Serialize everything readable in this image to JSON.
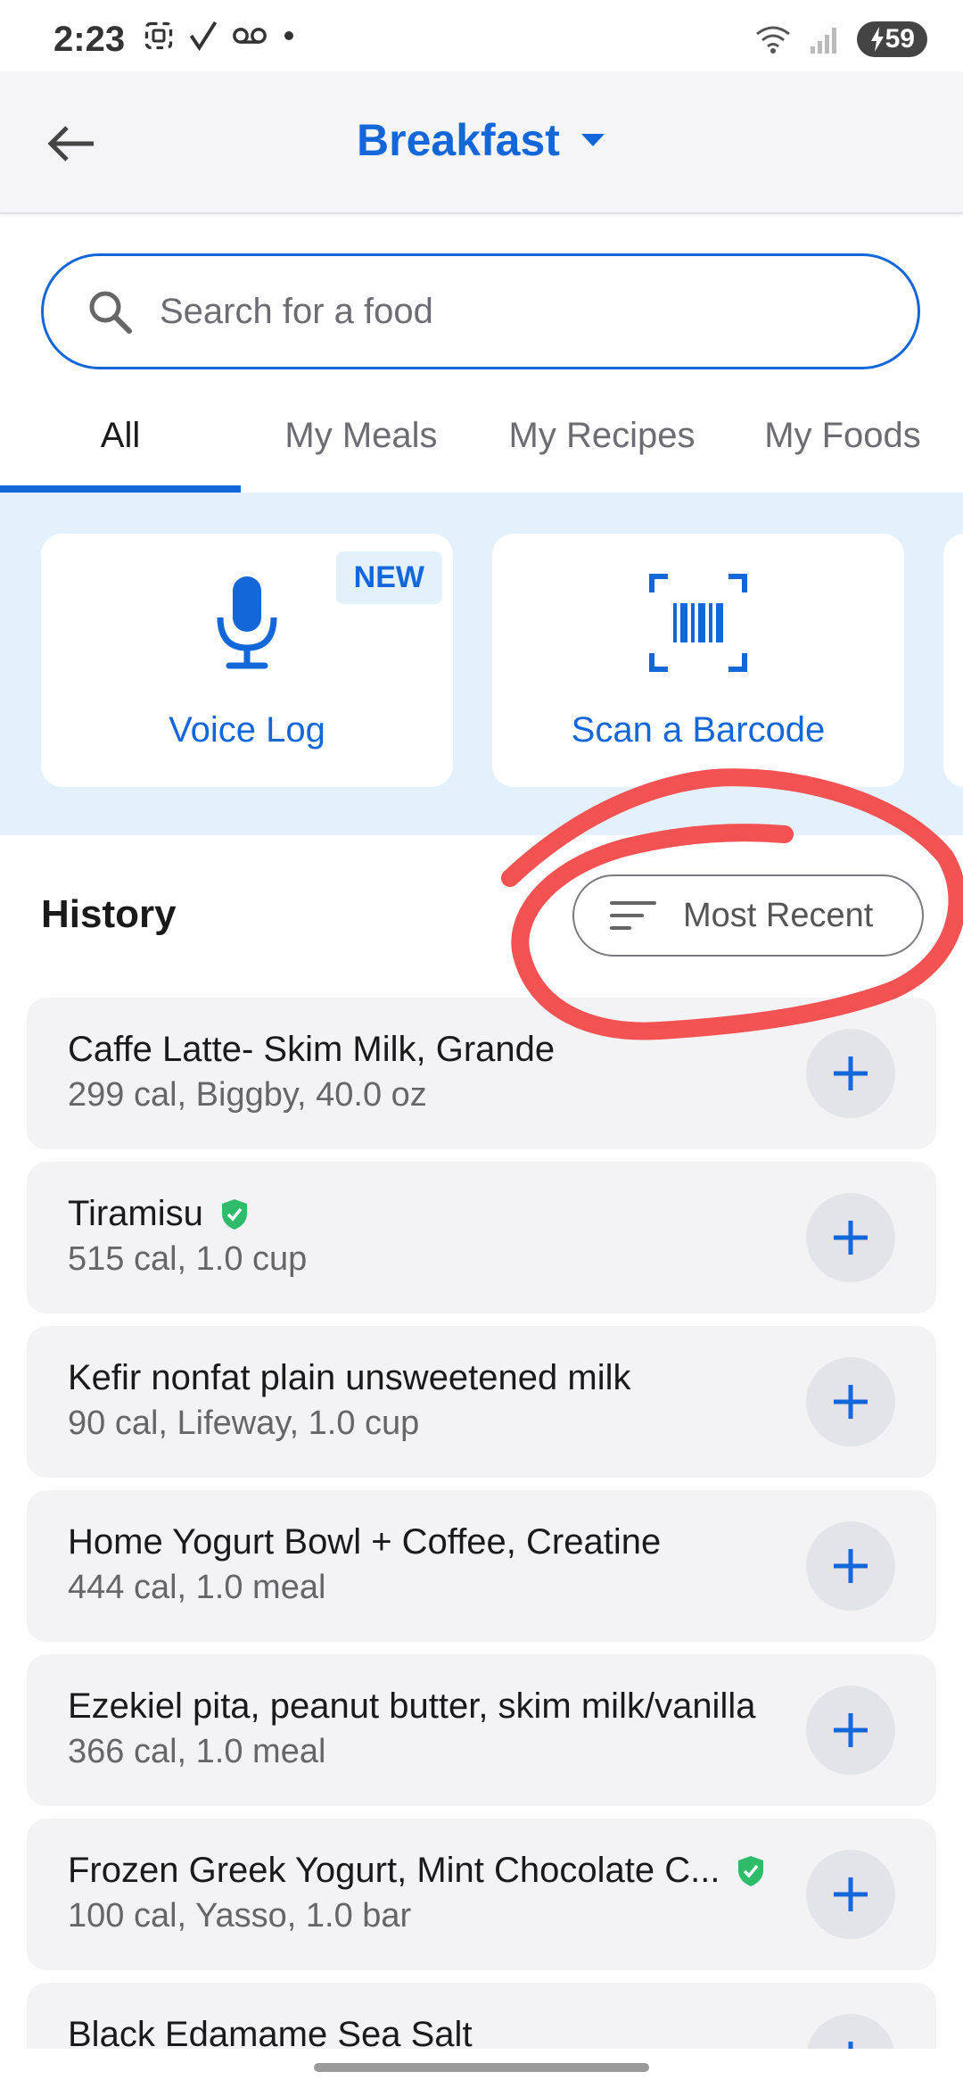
{
  "status_bar": {
    "time": "2:23",
    "left_icons": [
      "screenshot-icon",
      "check-icon",
      "voicemail-icon",
      "dot-icon"
    ],
    "right_icons": [
      "wifi-icon",
      "signal-icon"
    ],
    "battery": "59"
  },
  "header": {
    "title": "Breakfast",
    "title_color": "#1467d9"
  },
  "search": {
    "placeholder": "Search for a food"
  },
  "tabs": [
    {
      "label": "All",
      "active": true
    },
    {
      "label": "My Meals",
      "active": false
    },
    {
      "label": "My Recipes",
      "active": false
    },
    {
      "label": "My Foods",
      "active": false
    }
  ],
  "quick_actions": {
    "voice_log": {
      "label": "Voice Log",
      "badge": "NEW",
      "icon": "microphone-icon"
    },
    "scan_barcode": {
      "label": "Scan a Barcode",
      "icon": "barcode-icon"
    }
  },
  "history": {
    "title": "History",
    "sort_label": "Most Recent",
    "annotation_color": "#f25252"
  },
  "food_items": [
    {
      "name": "Caffe Latte- Skim Milk, Grande",
      "detail": "299 cal, Biggby, 40.0 oz",
      "verified": false
    },
    {
      "name": "Tiramisu",
      "detail": "515 cal, 1.0 cup",
      "verified": true
    },
    {
      "name": "Kefir nonfat plain unsweetened milk",
      "detail": "90 cal, Lifeway, 1.0 cup",
      "verified": false
    },
    {
      "name": "Home Yogurt Bowl + Coffee, Creatine",
      "detail": "444 cal, 1.0 meal",
      "verified": false
    },
    {
      "name": "Ezekiel pita, peanut butter, skim milk/vanilla",
      "detail": "366 cal, 1.0 meal",
      "verified": false
    },
    {
      "name": "Frozen Greek Yogurt, Mint Chocolate C...",
      "detail": "100 cal, Yasso, 1.0 bar",
      "verified": true
    },
    {
      "name": "Black Edamame Sea Salt",
      "detail": "",
      "verified": false
    }
  ],
  "colors": {
    "accent": "#1467d9",
    "verified": "#2ebc6a",
    "band": "#e3f1fc"
  }
}
